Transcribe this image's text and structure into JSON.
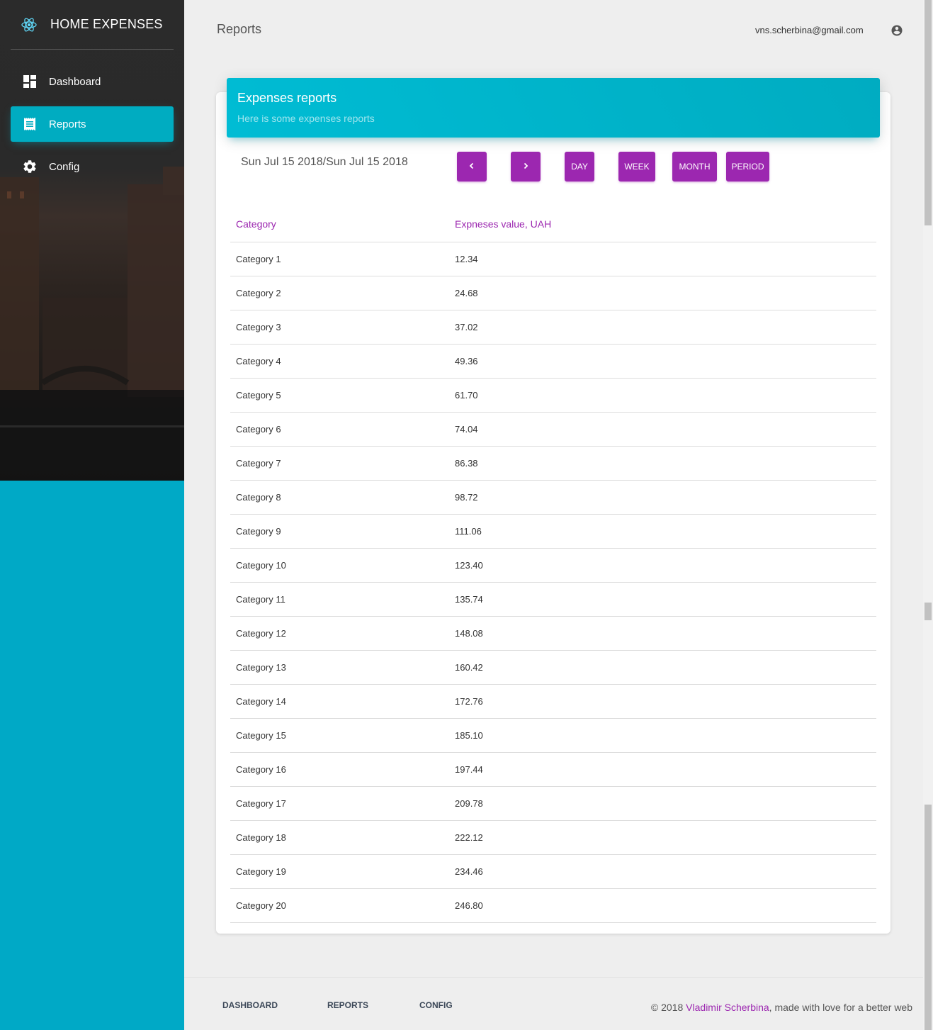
{
  "app": {
    "title": "HOME EXPENSES"
  },
  "sidebar": {
    "items": [
      {
        "label": "Dashboard",
        "icon": "dashboard-icon",
        "active": false
      },
      {
        "label": "Reports",
        "icon": "receipt-icon",
        "active": true
      },
      {
        "label": "Config",
        "icon": "gear-icon",
        "active": false
      }
    ]
  },
  "header": {
    "title": "Reports",
    "user_email": "vns.scherbina@gmail.com",
    "user_icon": "account-circle-icon"
  },
  "card": {
    "title": "Expenses reports",
    "subtitle": "Here is some expenses reports",
    "date_range": "Sun Jul 15 2018/Sun Jul 15 2018",
    "buttons": {
      "prev": "‹",
      "next": "›",
      "day": "DAY",
      "week": "WEEK",
      "month": "MONTH",
      "period": "PERIOD"
    }
  },
  "table": {
    "headers": [
      "Category",
      "Expneses value, UAH"
    ],
    "rows": [
      [
        "Category 1",
        "12.34"
      ],
      [
        "Category 2",
        "24.68"
      ],
      [
        "Category 3",
        "37.02"
      ],
      [
        "Category 4",
        "49.36"
      ],
      [
        "Category 5",
        "61.70"
      ],
      [
        "Category 6",
        "74.04"
      ],
      [
        "Category 7",
        "86.38"
      ],
      [
        "Category 8",
        "98.72"
      ],
      [
        "Category 9",
        "111.06"
      ],
      [
        "Category 10",
        "123.40"
      ],
      [
        "Category 11",
        "135.74"
      ],
      [
        "Category 12",
        "148.08"
      ],
      [
        "Category 13",
        "160.42"
      ],
      [
        "Category 14",
        "172.76"
      ],
      [
        "Category 15",
        "185.10"
      ],
      [
        "Category 16",
        "197.44"
      ],
      [
        "Category 17",
        "209.78"
      ],
      [
        "Category 18",
        "222.12"
      ],
      [
        "Category 19",
        "234.46"
      ],
      [
        "Category 20",
        "246.80"
      ]
    ]
  },
  "footer": {
    "links": [
      "DASHBOARD",
      "REPORTS",
      "CONFIG"
    ],
    "copyright_prefix": "© 2018 ",
    "author": "Vladimir Scherbina",
    "copyright_suffix": ", made with love for a better web"
  },
  "colors": {
    "accent": "#9c27b0",
    "primary": "#00acc1",
    "sidebar_bottom": "#00a9c6"
  }
}
